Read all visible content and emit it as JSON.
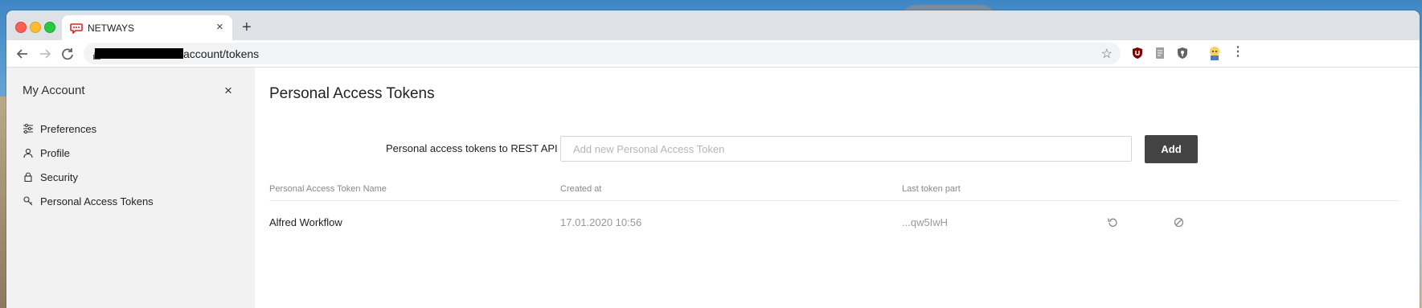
{
  "browser": {
    "tab_title": "NETWAYS",
    "new_tab": "+",
    "tab_close": "×",
    "url_path": "account/tokens"
  },
  "sidebar": {
    "title": "My Account",
    "close": "×",
    "items": [
      {
        "label": "Preferences",
        "icon": "sliders-icon"
      },
      {
        "label": "Profile",
        "icon": "user-icon"
      },
      {
        "label": "Security",
        "icon": "lock-icon"
      },
      {
        "label": "Personal Access Tokens",
        "icon": "key-icon"
      }
    ]
  },
  "main": {
    "title": "Personal Access Tokens",
    "form": {
      "label": "Personal access tokens to REST API",
      "input_placeholder": "Add new Personal Access Token",
      "input_value": "",
      "add_label": "Add"
    },
    "table": {
      "headers": [
        "Personal Access Token Name",
        "Created at",
        "Last token part"
      ],
      "rows": [
        {
          "name": "Alfred Workflow",
          "created": "17.01.2020 10:56",
          "last_part": "...qw5IwH"
        }
      ]
    }
  },
  "colors": {
    "accent_button": "#444444",
    "sidebar_bg": "#f2f2f2",
    "favicon": "#d9262b"
  }
}
